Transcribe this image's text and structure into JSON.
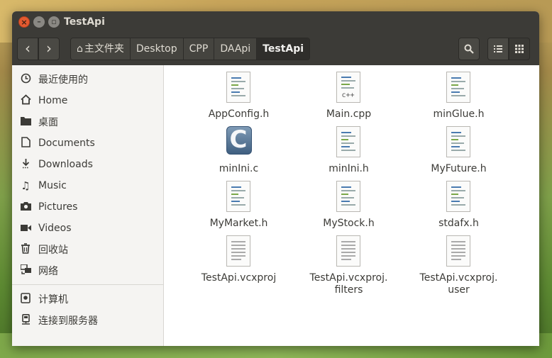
{
  "window": {
    "title": "TestApi"
  },
  "controls": {
    "close": "×",
    "minimize": "–",
    "maximize": "▫"
  },
  "nav": {
    "back": "‹",
    "forward": "›"
  },
  "breadcrumbs": [
    {
      "label": "主文件夹",
      "icon": "home-icon"
    },
    {
      "label": "Desktop"
    },
    {
      "label": "CPP"
    },
    {
      "label": "DAApi"
    },
    {
      "label": "TestApi",
      "active": true
    }
  ],
  "toolbar": {
    "search_icon": "search-icon",
    "list_view_icon": "list-view-icon",
    "grid_view_icon": "grid-view-icon"
  },
  "sidebar": {
    "items": [
      {
        "label": "最近使用的",
        "icon": "clock-icon"
      },
      {
        "label": "Home",
        "icon": "home-icon"
      },
      {
        "label": "桌面",
        "icon": "folder-icon"
      },
      {
        "label": "Documents",
        "icon": "document-icon"
      },
      {
        "label": "Downloads",
        "icon": "download-icon"
      },
      {
        "label": "Music",
        "icon": "music-icon"
      },
      {
        "label": "Pictures",
        "icon": "camera-icon"
      },
      {
        "label": "Videos",
        "icon": "video-icon"
      },
      {
        "label": "回收站",
        "icon": "trash-icon"
      },
      {
        "label": "网络",
        "icon": "network-icon"
      },
      {
        "label": "计算机",
        "icon": "computer-icon"
      },
      {
        "label": "连接到服务器",
        "icon": "server-icon"
      }
    ]
  },
  "files": [
    {
      "name": "AppConfig.h",
      "type": "header"
    },
    {
      "name": "Main.cpp",
      "type": "cpp",
      "tag": "c++"
    },
    {
      "name": "minGlue.h",
      "type": "header"
    },
    {
      "name": "minIni.c",
      "type": "c",
      "tag": "C"
    },
    {
      "name": "minIni.h",
      "type": "header"
    },
    {
      "name": "MyFuture.h",
      "type": "header"
    },
    {
      "name": "MyMarket.h",
      "type": "header"
    },
    {
      "name": "MyStock.h",
      "type": "header"
    },
    {
      "name": "stdafx.h",
      "type": "header"
    },
    {
      "name": "TestApi.vcxproj",
      "type": "text"
    },
    {
      "name": "TestApi.vcxproj.\nfilters",
      "type": "text"
    },
    {
      "name": "TestApi.vcxproj.\nuser",
      "type": "text"
    }
  ]
}
